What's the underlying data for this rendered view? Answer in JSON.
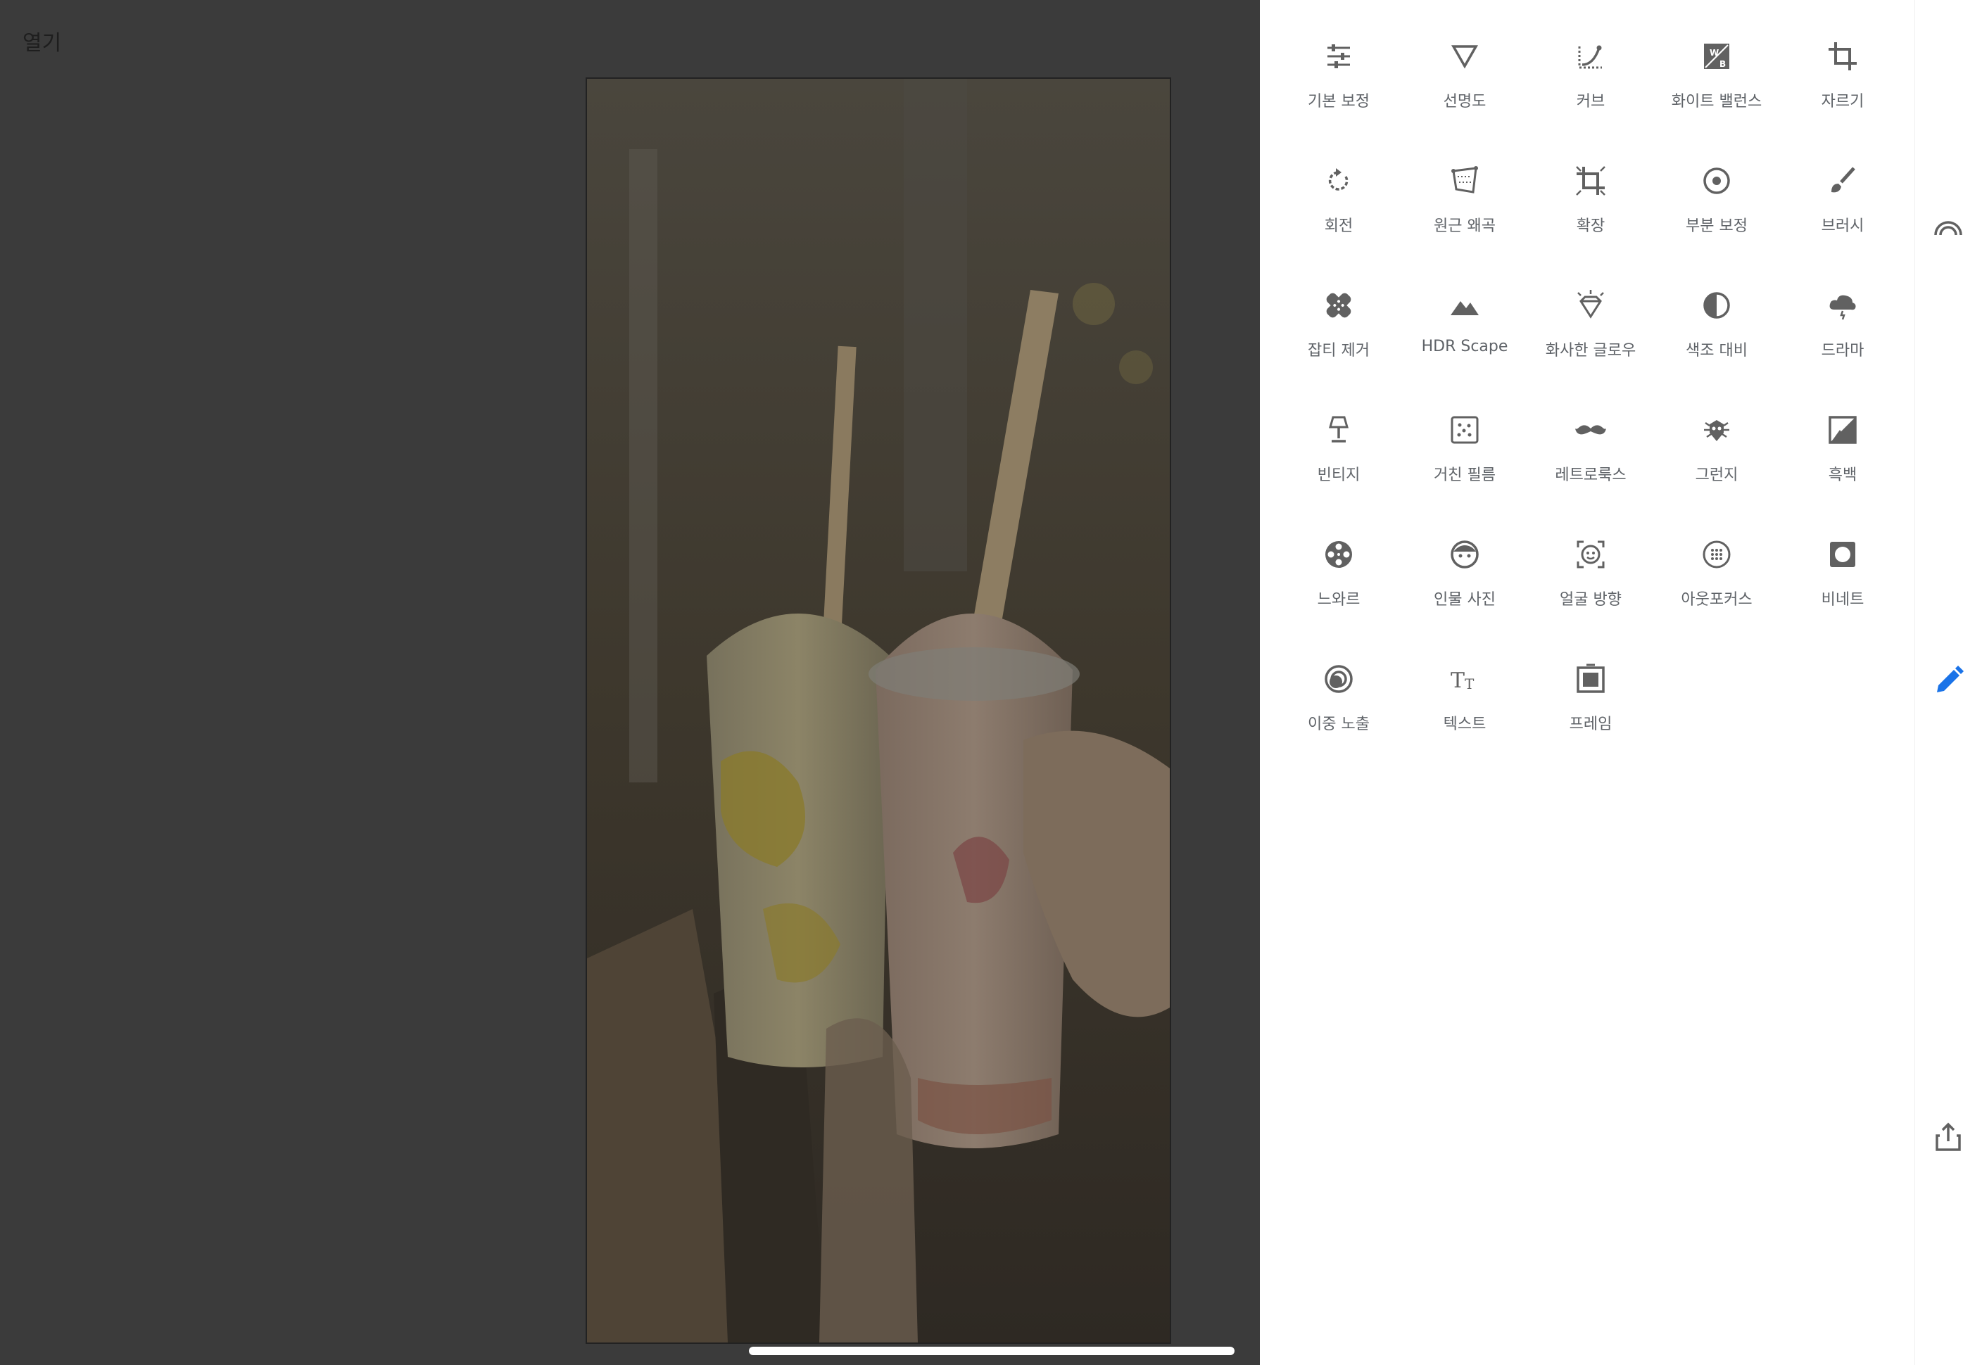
{
  "header": {
    "open_label": "열기"
  },
  "tools": [
    {
      "label": "기본 보정",
      "icon": "tune-icon"
    },
    {
      "label": "선명도",
      "icon": "details-triangle-icon"
    },
    {
      "label": "커브",
      "icon": "curves-icon"
    },
    {
      "label": "화이트 밸런스",
      "icon": "white-balance-icon"
    },
    {
      "label": "자르기",
      "icon": "crop-icon"
    },
    {
      "label": "회전",
      "icon": "rotate-icon"
    },
    {
      "label": "원근 왜곡",
      "icon": "perspective-icon"
    },
    {
      "label": "확장",
      "icon": "expand-icon"
    },
    {
      "label": "부분 보정",
      "icon": "selective-icon"
    },
    {
      "label": "브러시",
      "icon": "brush-icon"
    },
    {
      "label": "잡티 제거",
      "icon": "healing-icon"
    },
    {
      "label": "HDR Scape",
      "icon": "hdr-mountain-icon"
    },
    {
      "label": "화사한 글로우",
      "icon": "glamour-glow-icon"
    },
    {
      "label": "색조 대비",
      "icon": "tonal-contrast-icon"
    },
    {
      "label": "드라마",
      "icon": "drama-cloud-icon"
    },
    {
      "label": "빈티지",
      "icon": "vintage-lamp-icon"
    },
    {
      "label": "거친 필름",
      "icon": "grainy-film-icon"
    },
    {
      "label": "레트로룩스",
      "icon": "retrolux-mustache-icon"
    },
    {
      "label": "그런지",
      "icon": "grunge-icon"
    },
    {
      "label": "흑백",
      "icon": "black-white-icon"
    },
    {
      "label": "느와르",
      "icon": "noir-film-reel-icon"
    },
    {
      "label": "인물 사진",
      "icon": "portrait-face-icon"
    },
    {
      "label": "얼굴 방향",
      "icon": "head-pose-icon"
    },
    {
      "label": "아웃포커스",
      "icon": "lens-blur-icon"
    },
    {
      "label": "비네트",
      "icon": "vignette-icon"
    },
    {
      "label": "이중 노출",
      "icon": "double-exposure-icon"
    },
    {
      "label": "텍스트",
      "icon": "text-icon"
    },
    {
      "label": "프레임",
      "icon": "frames-icon"
    }
  ],
  "rail": [
    {
      "icon": "looks-icon"
    },
    {
      "icon": "tools-pencil-icon",
      "active": true,
      "color": "#1a73e8"
    },
    {
      "icon": "export-share-icon"
    }
  ],
  "colors": {
    "icon": "#616161",
    "label": "#5f6368",
    "accent": "#1a73e8",
    "dim_bg": "#3b3b3b"
  }
}
